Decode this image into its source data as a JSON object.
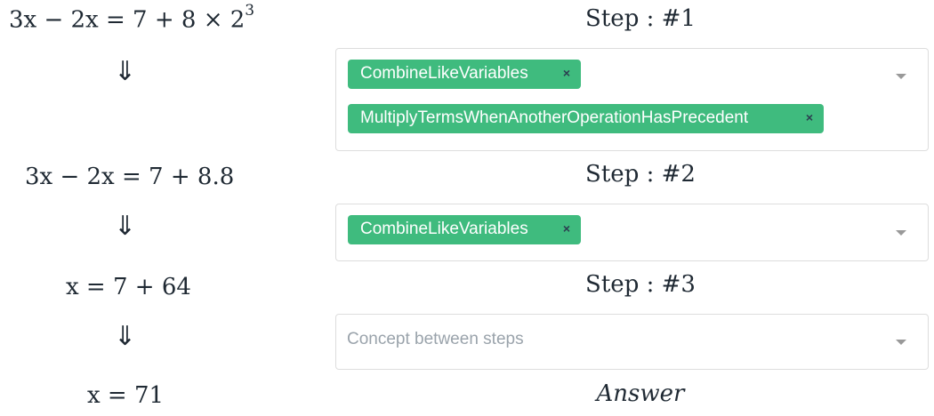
{
  "equations": {
    "eq1_lhs": "3x − 2x = 7 + 8 × 2",
    "eq1_exp": "3",
    "eq2": "3x − 2x = 7 + 8.8",
    "eq3": "x = 7 + 64",
    "eq4": "x = 71"
  },
  "arrow_glyph": "⇓",
  "steps": [
    {
      "label": "Step : #1",
      "tags": [
        "CombineLikeVariables",
        "MultiplyTermsWhenAnotherOperationHasPrecedent"
      ]
    },
    {
      "label": "Step : #2",
      "tags": [
        "CombineLikeVariables"
      ]
    },
    {
      "label": "Step : #3",
      "placeholder": "Concept between steps"
    }
  ],
  "answer_label": "Answer",
  "remove_glyph": "×",
  "colors": {
    "tag_bg": "#3fbb7e",
    "border": "#dddddd",
    "text": "#1f2933"
  }
}
